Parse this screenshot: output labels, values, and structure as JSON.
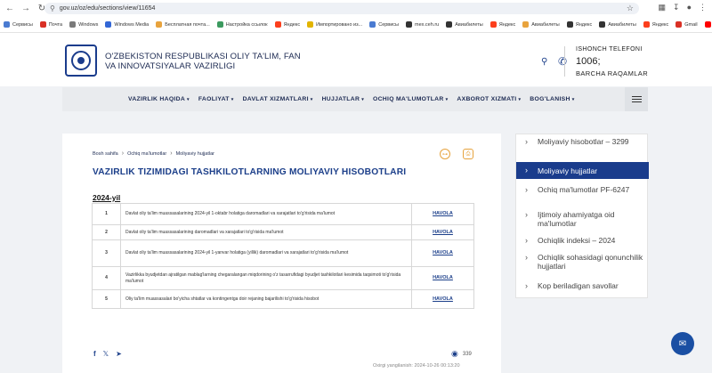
{
  "browser": {
    "url": "gov.uz/oz/edu/sections/view/11654",
    "bookmarks": [
      {
        "label": "Сервисы",
        "color": "#4a7bd1"
      },
      {
        "label": "Почта",
        "color": "#d93025"
      },
      {
        "label": "Windows",
        "color": "#7a7a7a"
      },
      {
        "label": "Windows Media",
        "color": "#3367d6"
      },
      {
        "label": "Бесплатная почта...",
        "color": "#e8a33d"
      },
      {
        "label": "Настройка ссылок",
        "color": "#3c9a5f"
      },
      {
        "label": "Яндекс",
        "color": "#fc3f1d"
      },
      {
        "label": "Импортировано из...",
        "color": "#e2b400"
      },
      {
        "label": "Сервисы",
        "color": "#4a7bd1"
      },
      {
        "label": "mex.ceh.ru",
        "color": "#333"
      },
      {
        "label": "Авиабилеты",
        "color": "#333"
      },
      {
        "label": "Яндекс",
        "color": "#fc3f1d"
      },
      {
        "label": "Авиабилеты",
        "color": "#e8a33d"
      },
      {
        "label": "Яндекс",
        "color": "#333"
      },
      {
        "label": "Авиабилеты",
        "color": "#333"
      },
      {
        "label": "Яндекс",
        "color": "#fc3f1d"
      },
      {
        "label": "Gmail",
        "color": "#d93025"
      },
      {
        "label": "YouTube",
        "color": "#ff0000"
      }
    ]
  },
  "header": {
    "org_name": "O'ZBEKISTON RESPUBLIKASI OLIY TA'LIM, FAN VA INNOVATSIYALAR VAZIRLIGI",
    "hotline_label": "ISHONCH TELEFONI",
    "hotline_number": "1006;",
    "hotline_sub": "BARCHA RAQAMLAR"
  },
  "menu": [
    {
      "label": "VAZIRLIK HAQIDA",
      "has_dropdown": true
    },
    {
      "label": "FAOLIYAT",
      "has_dropdown": true
    },
    {
      "label": "DAVLAT XIZMATLARI",
      "has_dropdown": true
    },
    {
      "label": "HUJJATLAR",
      "has_dropdown": true
    },
    {
      "label": "OCHIQ MA'LUMOTLAR",
      "has_dropdown": true
    },
    {
      "label": "AXBOROT XIZMATI",
      "has_dropdown": true
    },
    {
      "label": "BOG'LANISH",
      "has_dropdown": true
    }
  ],
  "breadcrumb": {
    "home": "Bosh sahifa",
    "section": "Ochiq ma'lumotlar",
    "current": "Moliyaviy hujjatlar"
  },
  "page": {
    "title": "VAZIRLIK TIZIMIDAGI TASHKILOTLARNING MOLIYAVIY HISOBOTLARI",
    "year": "2024-yil",
    "rows": [
      {
        "num": "1",
        "text": "Davlat oliy ta'lim muassasalarining 2024-yil 1-oktabr holatiga daromadlari va xarajatlari to'g'risida ma'lumot",
        "link": "HAVOLA"
      },
      {
        "num": "2",
        "text": "Davlat oliy ta'lim muassasalarining daromadlari va xarajatlari to'g'risida ma'lumot",
        "link": "HAVOLA"
      },
      {
        "num": "3",
        "text": "Davlat oliy ta'lim muassasalarining 2024-yil 1-yanvar holatiga (yillik) daromadlari va xarajatlari to'g'risida ma'lumot",
        "link": "HAVOLA"
      },
      {
        "num": "4",
        "text": "Vazirlikka byudjetdan ajratilgan mablag'larning chegaralangan miqdorining o'z tasarrufidagi byudjet tashkilotlari kesimida taqsimoti to'g'risida ma'lumot",
        "link": "HAVOLA"
      },
      {
        "num": "5",
        "text": "Oliy ta'lim muassasalari bo'yicha shtatlar va kontingentga doir rejaning bajarilishi to'g'risida hisobot",
        "link": "HAVOLA"
      }
    ],
    "views": "339",
    "updated": "Oxirgi yangilanish: 2024-10-26 00:13:20"
  },
  "sidebar": [
    {
      "label": "Moliyaviy hisobotlar – 3299",
      "active": false
    },
    {
      "label": "Moliyaviy hujjatlar",
      "active": true
    },
    {
      "label": "Ochiq ma'lumotlar PF-6247",
      "active": false
    },
    {
      "label": "Ijtimoiy ahamiyatga oid ma'lumotlar",
      "active": false
    },
    {
      "label": "Ochiqlik indeksi – 2024",
      "active": false
    },
    {
      "label": "Ochiqlik sohasidagi qonunchilik hujjatlari",
      "active": false
    },
    {
      "label": "Kop beriladigan savollar",
      "active": false
    }
  ],
  "colors": {
    "brand": "#1a3c8c",
    "accent": "#e6a23c"
  }
}
